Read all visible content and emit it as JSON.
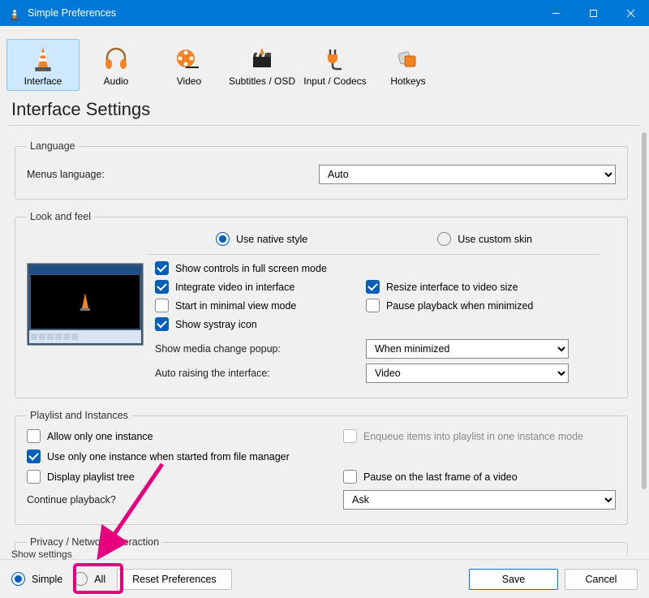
{
  "window": {
    "title": "Simple Preferences"
  },
  "tabs": {
    "interface": "Interface",
    "audio": "Audio",
    "video": "Video",
    "subtitles": "Subtitles / OSD",
    "input": "Input / Codecs",
    "hotkeys": "Hotkeys"
  },
  "page_title": "Interface Settings",
  "language": {
    "legend": "Language",
    "menus_label": "Menus language:",
    "value": "Auto"
  },
  "lookfeel": {
    "legend": "Look and feel",
    "native": "Use native style",
    "custom": "Use custom skin",
    "show_controls_fs": "Show controls in full screen mode",
    "integrate_video": "Integrate video in interface",
    "resize_interface": "Resize interface to video size",
    "start_minimal": "Start in minimal view mode",
    "pause_minimized": "Pause playback when minimized",
    "systray": "Show systray icon",
    "media_change_label": "Show media change popup:",
    "media_change_value": "When minimized",
    "auto_raise_label": "Auto raising the interface:",
    "auto_raise_value": "Video"
  },
  "playlist": {
    "legend": "Playlist and Instances",
    "one_instance": "Allow only one instance",
    "enqueue": "Enqueue items into playlist in one instance mode",
    "one_instance_fm": "Use only one instance when started from file manager",
    "display_tree": "Display playlist tree",
    "pause_last_frame": "Pause on the last frame of a video",
    "continue_label": "Continue playback?",
    "continue_value": "Ask"
  },
  "privacy": {
    "legend": "Privacy / Network Interaction"
  },
  "bottom": {
    "show_settings": "Show settings",
    "simple": "Simple",
    "all": "All",
    "reset": "Reset Preferences",
    "save": "Save",
    "cancel": "Cancel"
  }
}
